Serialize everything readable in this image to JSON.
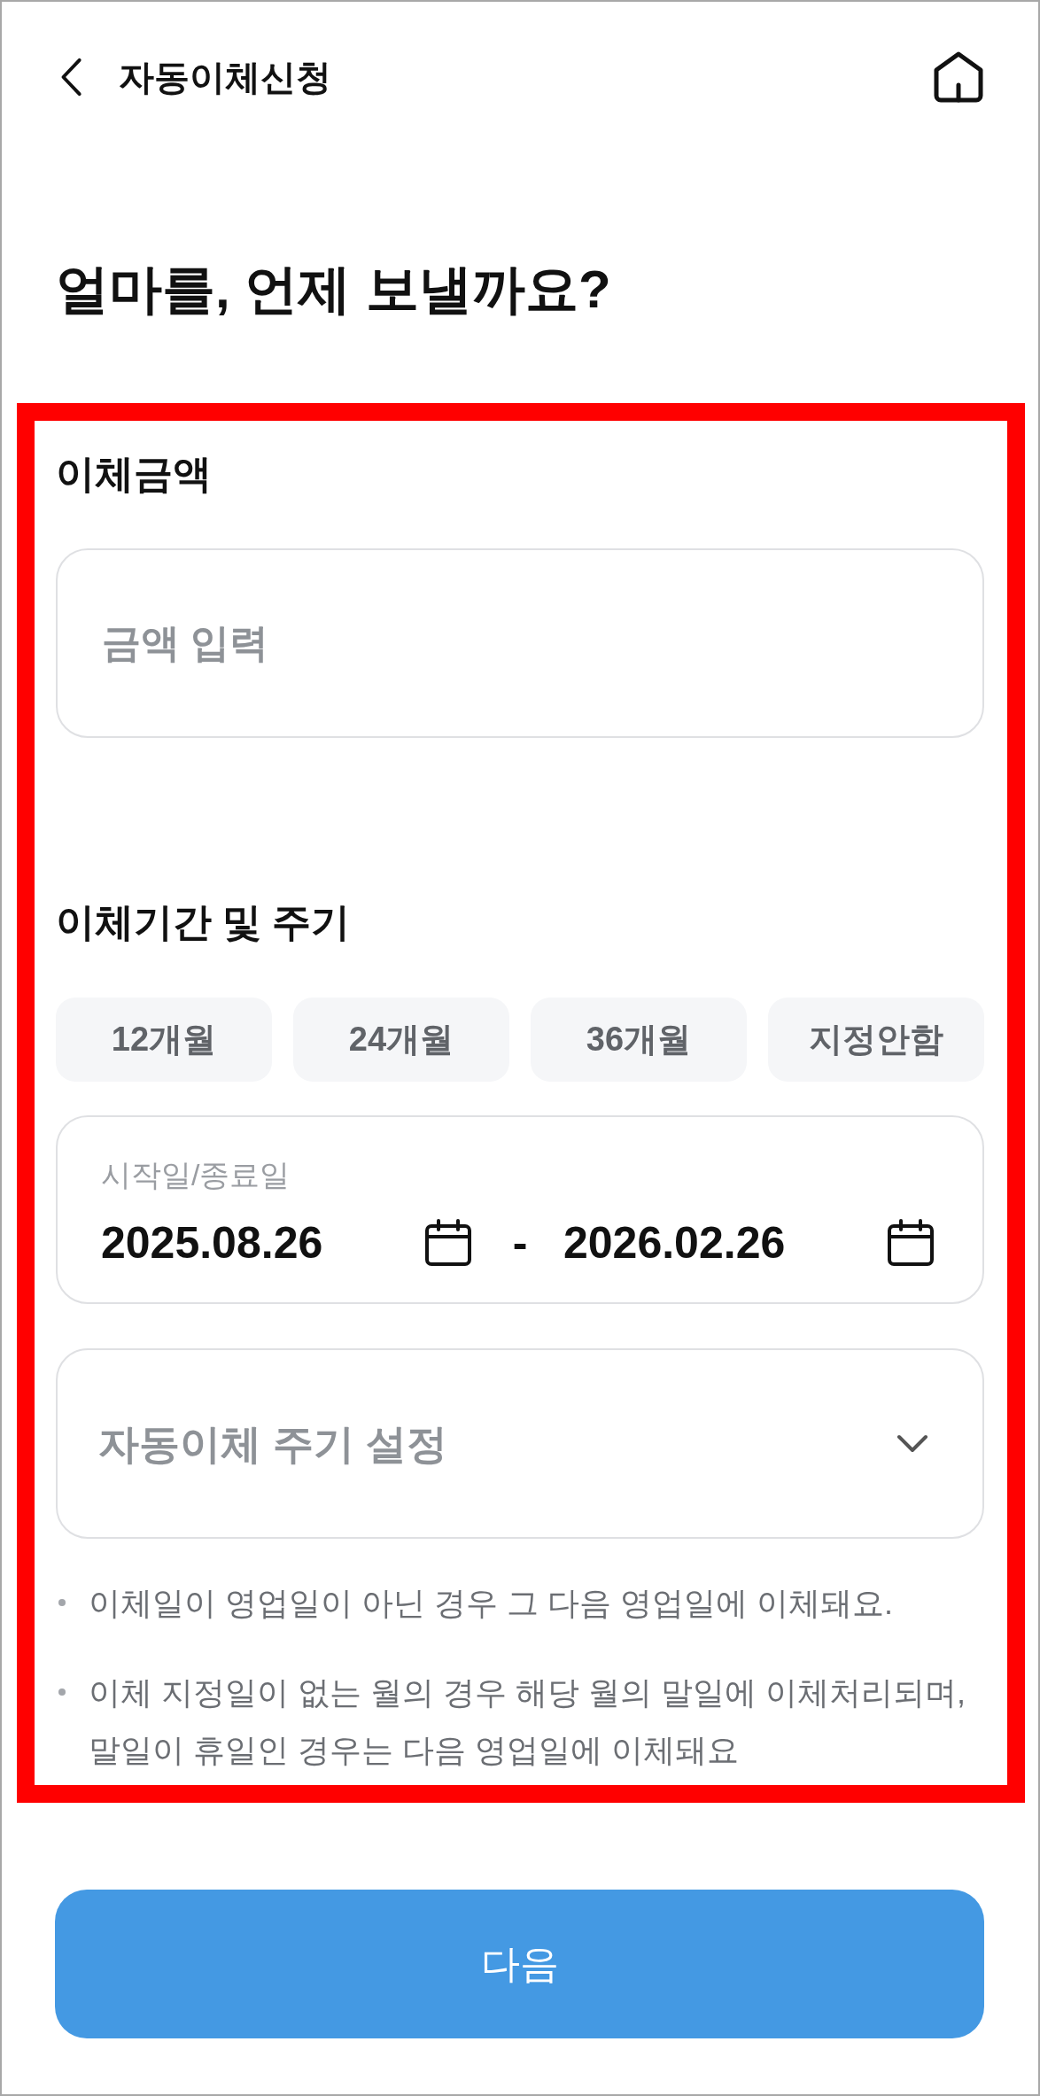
{
  "header": {
    "title": "자동이체신청"
  },
  "heading": "얼마를, 언제 보낼까요?",
  "amount": {
    "label": "이체금액",
    "input": {
      "placeholder": "금액 입력"
    }
  },
  "period": {
    "label": "이체기간 및 주기",
    "options": [
      {
        "label": "12개월",
        "selected": false
      },
      {
        "label": "24개월",
        "selected": false
      },
      {
        "label": "36개월",
        "selected": false
      },
      {
        "label": "지정안함",
        "selected": false
      }
    ],
    "date_range": {
      "label": "시작일/종료일",
      "start": "2025.08.26",
      "separator": "-",
      "end": "2026.02.26"
    },
    "cycle": {
      "placeholder": "자동이체 주기 설정",
      "expanded": false
    }
  },
  "notes": [
    "이체일이 영업일이 아닌 경우 그 다음 영업일에 이체돼요.",
    "이체 지정일이 없는 월의 경우 해당 월의 말일에 이체처리되며, 말일이 휴일인 경우는 다음 영업일에 이체돼요"
  ],
  "next_button": {
    "label": "다음"
  }
}
